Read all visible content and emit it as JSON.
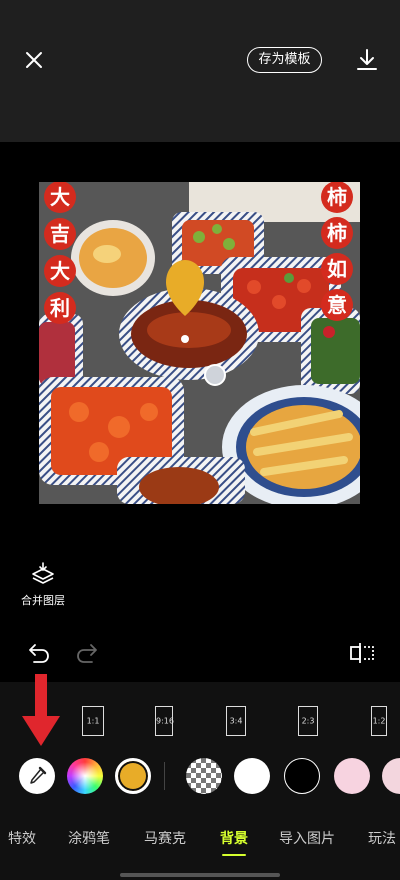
{
  "header": {
    "save_template_label": "存为模板"
  },
  "photo": {
    "left_characters": [
      "大",
      "吉",
      "大",
      "利"
    ],
    "right_characters": [
      "柿",
      "柿",
      "如",
      "意"
    ],
    "marker_color": "#e8ac28"
  },
  "tools": {
    "merge_layers_label": "合并图层"
  },
  "ratios": [
    "1:1",
    "9:16",
    "3:4",
    "2:3",
    "1:2"
  ],
  "colors": {
    "selected": "#e8ac28",
    "accent": "#d6ff2e",
    "swatches": [
      "#ffffff",
      "#000000",
      "#f7d3e0",
      "#f3d6de"
    ]
  },
  "tabs": [
    "特效",
    "涂鸦笔",
    "马赛克",
    "背景",
    "导入图片",
    "玩法"
  ],
  "active_tab": "背景"
}
